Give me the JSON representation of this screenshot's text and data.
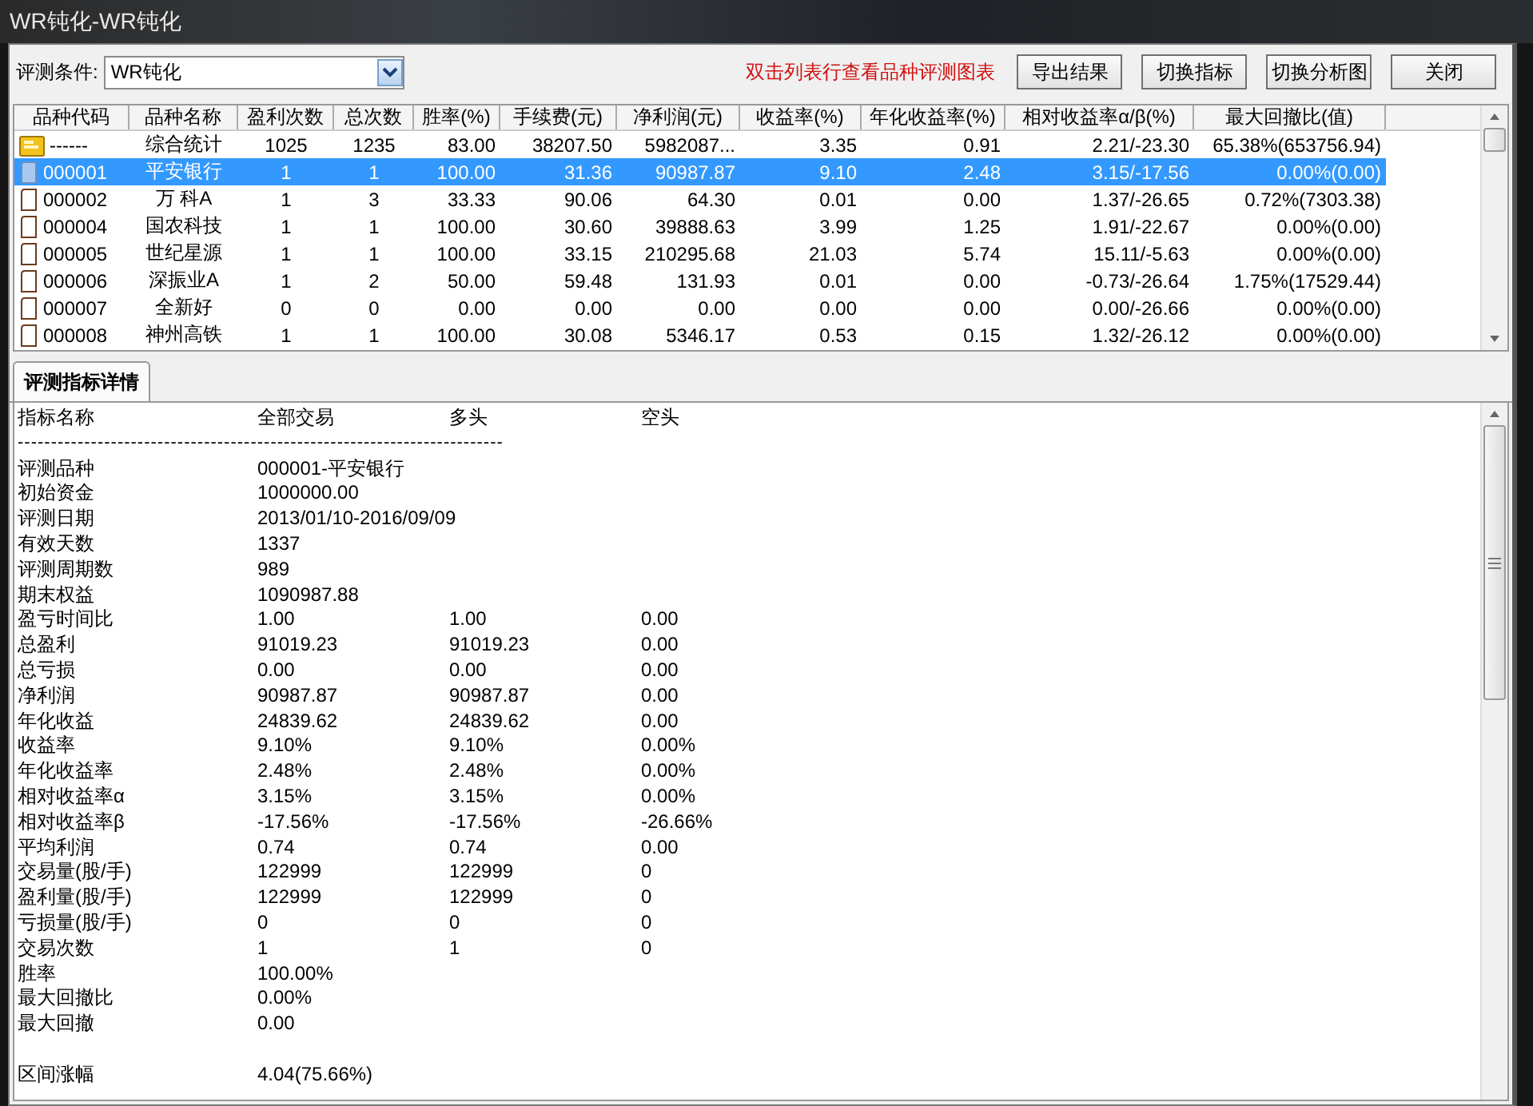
{
  "window": {
    "title": "WR钝化-WR钝化"
  },
  "toolbar": {
    "condition_label": "评测条件:",
    "condition_value": "WR钝化",
    "hint": "双击列表行查看品种评测图表",
    "buttons": [
      "导出结果",
      "切换指标",
      "切换分析图",
      "关闭"
    ]
  },
  "table": {
    "columns": [
      "品种代码",
      "品种名称",
      "盈利次数",
      "总次数",
      "胜率(%)",
      "手续费(元)",
      "净利润(元)",
      "收益率(%)",
      "年化收益率(%)",
      "相对收益率α/β(%)",
      "最大回撤比(值)"
    ],
    "rows": [
      {
        "kind": "summary",
        "selected": false,
        "cells": [
          "------",
          "综合统计",
          "1025",
          "1235",
          "83.00",
          "38207.50",
          "5982087...",
          "3.35",
          "0.91",
          "2.21/-23.30",
          "65.38%(653756.94)"
        ]
      },
      {
        "kind": "stock",
        "selected": true,
        "cells": [
          "000001",
          "平安银行",
          "1",
          "1",
          "100.00",
          "31.36",
          "90987.87",
          "9.10",
          "2.48",
          "3.15/-17.56",
          "0.00%(0.00)"
        ]
      },
      {
        "kind": "stock",
        "selected": false,
        "cells": [
          "000002",
          "万 科A",
          "1",
          "3",
          "33.33",
          "90.06",
          "64.30",
          "0.01",
          "0.00",
          "1.37/-26.65",
          "0.72%(7303.38)"
        ]
      },
      {
        "kind": "stock",
        "selected": false,
        "cells": [
          "000004",
          "国农科技",
          "1",
          "1",
          "100.00",
          "30.60",
          "39888.63",
          "3.99",
          "1.25",
          "1.91/-22.67",
          "0.00%(0.00)"
        ]
      },
      {
        "kind": "stock",
        "selected": false,
        "cells": [
          "000005",
          "世纪星源",
          "1",
          "1",
          "100.00",
          "33.15",
          "210295.68",
          "21.03",
          "5.74",
          "15.11/-5.63",
          "0.00%(0.00)"
        ]
      },
      {
        "kind": "stock",
        "selected": false,
        "cells": [
          "000006",
          "深振业A",
          "1",
          "2",
          "50.00",
          "59.48",
          "131.93",
          "0.01",
          "0.00",
          "-0.73/-26.64",
          "1.75%(17529.44)"
        ]
      },
      {
        "kind": "stock",
        "selected": false,
        "cells": [
          "000007",
          "全新好",
          "0",
          "0",
          "0.00",
          "0.00",
          "0.00",
          "0.00",
          "0.00",
          "0.00/-26.66",
          "0.00%(0.00)"
        ]
      },
      {
        "kind": "stock",
        "selected": false,
        "cells": [
          "000008",
          "神州高铁",
          "1",
          "1",
          "100.00",
          "30.08",
          "5346.17",
          "0.53",
          "0.15",
          "1.32/-26.12",
          "0.00%(0.00)"
        ]
      }
    ]
  },
  "tabs": [
    {
      "label": "评测指标详情",
      "selected": true
    }
  ],
  "details": {
    "columns": [
      "指标名称",
      "全部交易",
      "多头",
      "空头"
    ],
    "separator": "-------------------------------------------------------------------------",
    "rows": [
      {
        "kind": "line",
        "values": [
          "评测品种",
          "000001-平安银行"
        ]
      },
      {
        "kind": "line",
        "values": [
          "初始资金",
          "1000000.00"
        ]
      },
      {
        "kind": "line",
        "values": [
          "评测日期",
          "2013/01/10-2016/09/09"
        ]
      },
      {
        "kind": "line",
        "values": [
          "有效天数",
          "1337"
        ]
      },
      {
        "kind": "line",
        "values": [
          "评测周期数",
          "989"
        ]
      },
      {
        "kind": "line",
        "values": [
          "期末权益",
          "1090987.88"
        ]
      },
      {
        "kind": "line",
        "values": [
          "盈亏时间比",
          "1.00",
          "1.00",
          "0.00"
        ]
      },
      {
        "kind": "line",
        "values": [
          "总盈利",
          "91019.23",
          "91019.23",
          "0.00"
        ]
      },
      {
        "kind": "line",
        "values": [
          "总亏损",
          "0.00",
          "0.00",
          "0.00"
        ]
      },
      {
        "kind": "line",
        "values": [
          "净利润",
          "90987.87",
          "90987.87",
          "0.00"
        ]
      },
      {
        "kind": "line",
        "values": [
          "年化收益",
          "24839.62",
          "24839.62",
          "0.00"
        ]
      },
      {
        "kind": "line",
        "values": [
          "收益率",
          "9.10%",
          "9.10%",
          "0.00%"
        ]
      },
      {
        "kind": "line",
        "values": [
          "年化收益率",
          "2.48%",
          "2.48%",
          "0.00%"
        ]
      },
      {
        "kind": "line",
        "values": [
          "相对收益率α",
          "3.15%",
          "3.15%",
          "0.00%"
        ]
      },
      {
        "kind": "line",
        "values": [
          "相对收益率β",
          "-17.56%",
          "-17.56%",
          "-26.66%"
        ]
      },
      {
        "kind": "line",
        "values": [
          "平均利润",
          "0.74",
          "0.74",
          "0.00"
        ]
      },
      {
        "kind": "line",
        "values": [
          "交易量(股/手)",
          "122999",
          "122999",
          "0"
        ]
      },
      {
        "kind": "line",
        "values": [
          "盈利量(股/手)",
          "122999",
          "122999",
          "0"
        ]
      },
      {
        "kind": "line",
        "values": [
          "亏损量(股/手)",
          "0",
          "0",
          "0"
        ]
      },
      {
        "kind": "line",
        "values": [
          "交易次数",
          "1",
          "1",
          "0"
        ]
      },
      {
        "kind": "line",
        "values": [
          "胜率",
          "100.00%"
        ]
      },
      {
        "kind": "line",
        "values": [
          "最大回撤比",
          "0.00%"
        ]
      },
      {
        "kind": "line",
        "values": [
          "最大回撤",
          "0.00"
        ]
      },
      {
        "kind": "blank"
      },
      {
        "kind": "line",
        "values": [
          "区间涨幅",
          "4.04(75.66%)"
        ]
      }
    ]
  }
}
